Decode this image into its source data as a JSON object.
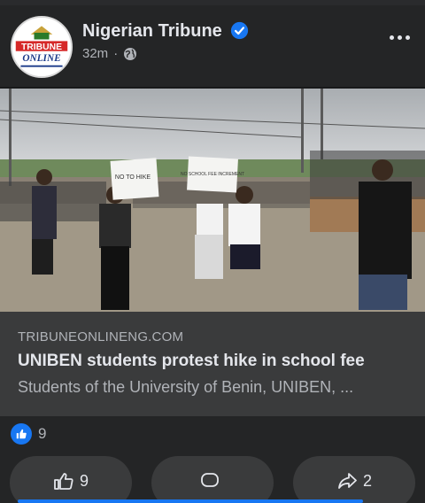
{
  "post": {
    "page_name": "Nigerian Tribune",
    "time": "32m",
    "separator": "·",
    "avatar_text_top": "TRIBUNE",
    "avatar_text_bottom": "ONLINE"
  },
  "photo": {
    "sign_1": "NO TO HIKE",
    "sign_2": "NO SCHOOL FEE INCREMENT"
  },
  "link_preview": {
    "domain": "TRIBUNEONLINENG.COM",
    "headline": "UNIBEN students protest hike in school fee",
    "description": "Students of the University of Benin, UNIBEN, ..."
  },
  "reactions": {
    "count": "9",
    "icon": "like-icon"
  },
  "actions": {
    "like_count": "9",
    "comment_count": "",
    "share_count": "2"
  },
  "colors": {
    "background": "#242526",
    "preview_bg": "#3a3b3c",
    "accent": "#1877f2",
    "primary_text": "#e4e6eb",
    "secondary_text": "#b0b3b8"
  }
}
